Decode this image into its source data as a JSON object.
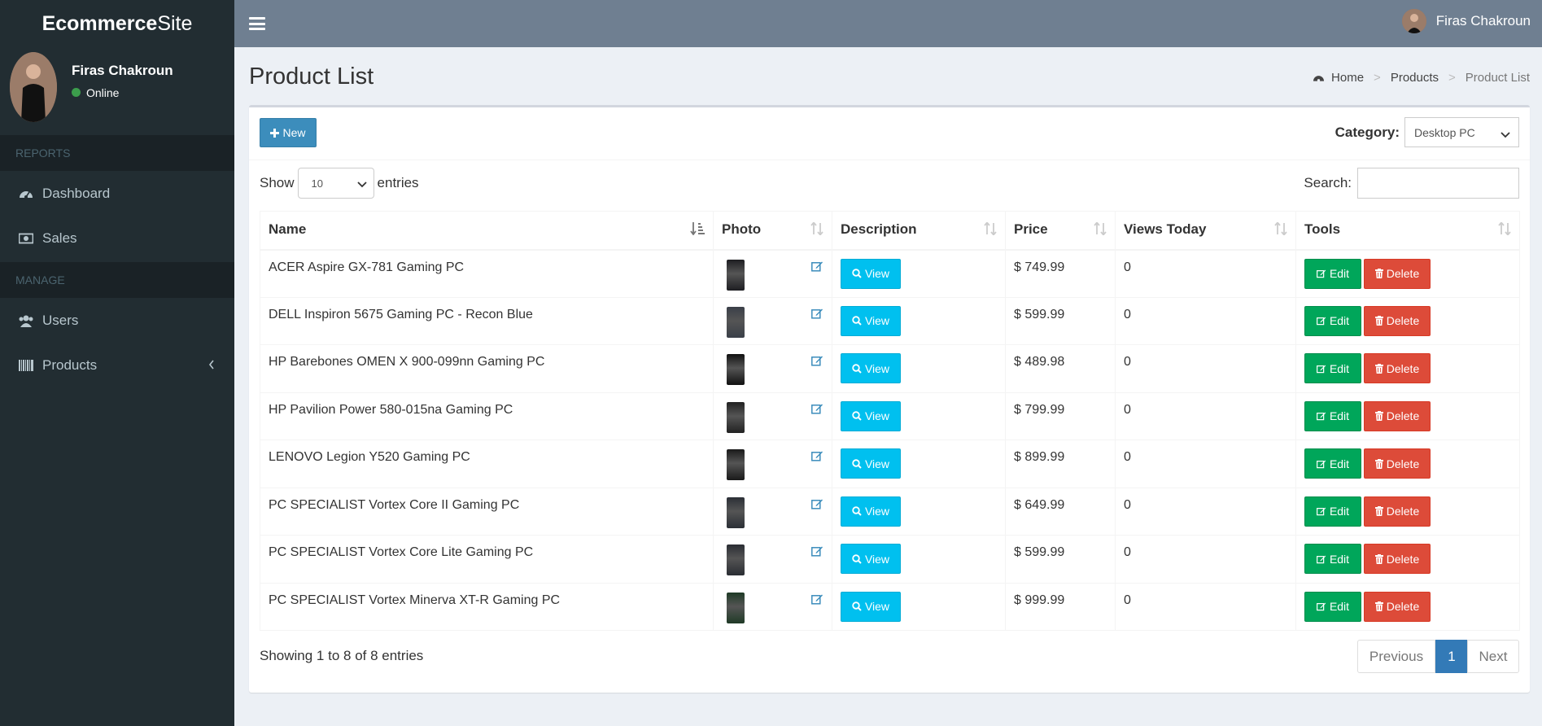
{
  "app": {
    "logo_bold": "Ecommerce",
    "logo_light": "Site"
  },
  "user": {
    "name": "Firas Chakroun",
    "status": "Online"
  },
  "sidebar": {
    "reports_header": "REPORTS",
    "manage_header": "MANAGE",
    "items": [
      {
        "label": "Dashboard",
        "icon": "dashboard-icon"
      },
      {
        "label": "Sales",
        "icon": "money-icon"
      },
      {
        "label": "Users",
        "icon": "users-icon"
      },
      {
        "label": "Products",
        "icon": "barcode-icon"
      }
    ]
  },
  "page": {
    "title": "Product List",
    "breadcrumb": [
      "Home",
      "Products",
      "Product List"
    ]
  },
  "toolbar": {
    "new_label": "New",
    "category_label": "Category:",
    "category_value": "Desktop PC"
  },
  "table_controls": {
    "show_label": "Show",
    "entries_label": "entries",
    "length_value": "10",
    "search_label": "Search:"
  },
  "columns": [
    "Name",
    "Photo",
    "Description",
    "Price",
    "Views Today",
    "Tools"
  ],
  "buttons": {
    "view": "View",
    "edit": "Edit",
    "delete": "Delete"
  },
  "rows": [
    {
      "name": "ACER Aspire GX-781 Gaming PC",
      "price": "$ 749.99",
      "views": "0",
      "img_color": "#1e1e22"
    },
    {
      "name": "DELL Inspiron 5675 Gaming PC - Recon Blue",
      "price": "$ 599.99",
      "views": "0",
      "img_color": "#3a3f48"
    },
    {
      "name": "HP Barebones OMEN X 900-099nn Gaming PC",
      "price": "$ 489.98",
      "views": "0",
      "img_color": "#111111"
    },
    {
      "name": "HP Pavilion Power 580-015na Gaming PC",
      "price": "$ 799.99",
      "views": "0",
      "img_color": "#222222"
    },
    {
      "name": "LENOVO Legion Y520 Gaming PC",
      "price": "$ 899.99",
      "views": "0",
      "img_color": "#1a1a1a"
    },
    {
      "name": "PC SPECIALIST Vortex Core II Gaming PC",
      "price": "$ 649.99",
      "views": "0",
      "img_color": "#2b2f36"
    },
    {
      "name": "PC SPECIALIST Vortex Core Lite Gaming PC",
      "price": "$ 599.99",
      "views": "0",
      "img_color": "#2a2d33"
    },
    {
      "name": "PC SPECIALIST Vortex Minerva XT-R Gaming PC",
      "price": "$ 999.99",
      "views": "0",
      "img_color": "#1f3a26"
    }
  ],
  "footer": {
    "info": "Showing 1 to 8 of 8 entries",
    "prev": "Previous",
    "page": "1",
    "next": "Next"
  },
  "colors": {
    "primary": "#3c8dbc",
    "info": "#00c0ef",
    "success": "#00a65a",
    "danger": "#dd4b39",
    "sidebar": "#222d32",
    "topbar": "#6f7f91"
  }
}
